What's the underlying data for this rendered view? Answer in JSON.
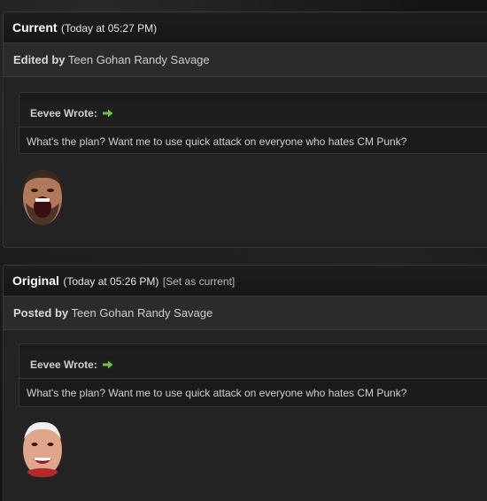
{
  "current": {
    "title": "Current",
    "time": "(Today at 05:27 PM)",
    "by_label": "Edited by",
    "by_name": "Teen Gohan Randy Savage",
    "quote_author": "Eevee Wrote:",
    "quote_text": "What's the plan? Want me to use quick attack on everyone who hates CM Punk?"
  },
  "original": {
    "title": "Original",
    "time": "(Today at 05:26 PM)",
    "set_current": "[Set as current]",
    "by_label": "Posted by",
    "by_name": "Teen Gohan Randy Savage",
    "quote_author": "Eevee Wrote:",
    "quote_text": "What's the plan? Want me to use quick attack on everyone who hates CM Punk?"
  },
  "colors": {
    "arrow": "#6fbf4a",
    "background": "#151515",
    "panel": "#232323"
  },
  "icons": {
    "quote_link": "green-right-arrow-icon"
  }
}
